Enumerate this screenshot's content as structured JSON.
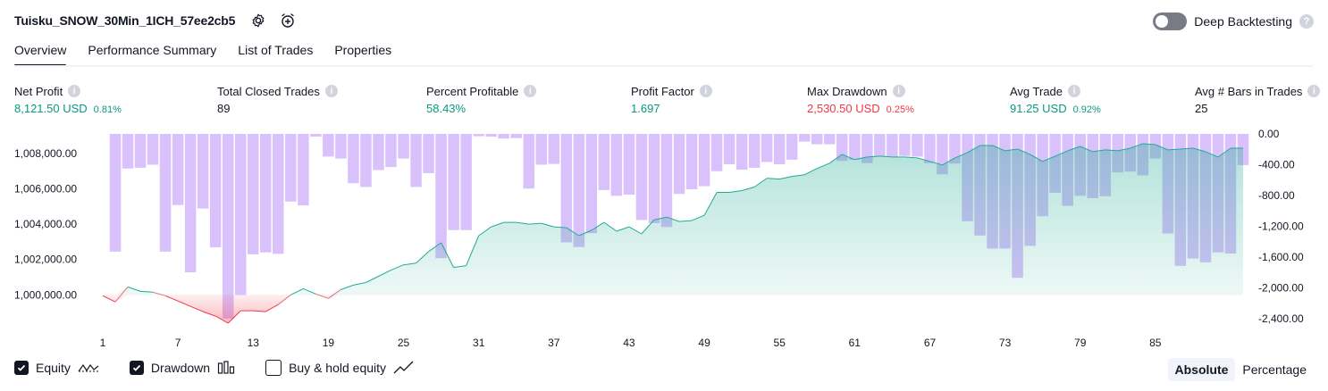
{
  "header": {
    "strategy_name": "Tuisku_SNOW_30Min_1ICH_57ee2cb5",
    "deep_backtesting_label": "Deep Backtesting",
    "deep_backtesting_enabled": false
  },
  "tabs": [
    {
      "label": "Overview",
      "active": true
    },
    {
      "label": "Performance Summary",
      "active": false
    },
    {
      "label": "List of Trades",
      "active": false
    },
    {
      "label": "Properties",
      "active": false
    }
  ],
  "stats": {
    "net_profit": {
      "label": "Net Profit",
      "value": "8,121.50 USD",
      "pct": "0.81%"
    },
    "total_closed_trades": {
      "label": "Total Closed Trades",
      "value": "89"
    },
    "percent_profitable": {
      "label": "Percent Profitable",
      "value": "58.43%"
    },
    "profit_factor": {
      "label": "Profit Factor",
      "value": "1.697"
    },
    "max_drawdown": {
      "label": "Max Drawdown",
      "value": "2,530.50 USD",
      "pct": "0.25%"
    },
    "avg_trade": {
      "label": "Avg Trade",
      "value": "91.25 USD",
      "pct": "0.92%"
    },
    "avg_bars": {
      "label": "Avg # Bars in Trades",
      "value": "25"
    }
  },
  "chart_data": {
    "type": "area",
    "x_ticks": [
      "1",
      "7",
      "13",
      "19",
      "25",
      "31",
      "37",
      "43",
      "49",
      "55",
      "61",
      "67",
      "73",
      "79",
      "85"
    ],
    "left_axis": {
      "ticks": [
        "1,008,000.00",
        "1,006,000.00",
        "1,004,000.00",
        "1,002,000.00",
        "1,000,000.00"
      ],
      "values": [
        1008000,
        1006000,
        1004000,
        1002000,
        1000000
      ],
      "ylim": [
        998400,
        1008500
      ]
    },
    "right_axis": {
      "ticks": [
        "0.00",
        "-400.00",
        "-800.00",
        "-1,200.00",
        "-1,600.00",
        "-2,000.00",
        "-2,400.00"
      ],
      "values": [
        0,
        -400,
        -800,
        -1200,
        -1600,
        -2000,
        -2400
      ],
      "ylim": [
        -2460,
        0
      ]
    },
    "initial_capital": 1000000,
    "equity": [
      999950,
      999600,
      1000450,
      1000200,
      1000150,
      999950,
      999650,
      999350,
      999050,
      998800,
      998400,
      999100,
      999100,
      999050,
      999450,
      1000000,
      1000350,
      1000050,
      999800,
      1000300,
      1000550,
      1000700,
      1001050,
      1001400,
      1001700,
      1001800,
      1002450,
      1002950,
      1001550,
      1001650,
      1003350,
      1003850,
      1004100,
      1004100,
      1004000,
      1004050,
      1003850,
      1003800,
      1003350,
      1003650,
      1004100,
      1003600,
      1003850,
      1003450,
      1004250,
      1004400,
      1004150,
      1004200,
      1004500,
      1005800,
      1005800,
      1005900,
      1006100,
      1006600,
      1006550,
      1006700,
      1006800,
      1007150,
      1007450,
      1007950,
      1007650,
      1007800,
      1007850,
      1007800,
      1007800,
      1007750,
      1007550,
      1007350,
      1007750,
      1008050,
      1008450,
      1008450,
      1008150,
      1008250,
      1007950,
      1007550,
      1007850,
      1008150,
      1008400,
      1008100,
      1008200,
      1008150,
      1008300,
      1008550,
      1008500,
      1008200,
      1008250,
      1008300,
      1008100,
      1007800,
      1008300,
      1008300
    ],
    "drawdown": [
      0,
      -1530,
      -450,
      -440,
      -400,
      -1530,
      -925,
      -1800,
      -970,
      -1475,
      -2400,
      -2095,
      -1565,
      -1540,
      -1560,
      -880,
      -930,
      -35,
      -295,
      -320,
      -640,
      -690,
      -470,
      -430,
      -320,
      -690,
      -510,
      -1615,
      -1250,
      -1250,
      -30,
      -35,
      -60,
      -55,
      -710,
      -400,
      -390,
      -1410,
      -1470,
      -1290,
      -730,
      -805,
      -790,
      -1120,
      -1160,
      -1210,
      -780,
      -720,
      -680,
      -485,
      -395,
      -465,
      -440,
      -365,
      -395,
      -335,
      -100,
      -135,
      -135,
      -350,
      -335,
      -380,
      -295,
      -300,
      -285,
      -295,
      -380,
      -525,
      -385,
      -1135,
      -1320,
      -1490,
      -1490,
      -1870,
      -1455,
      -1070,
      -765,
      -935,
      -805,
      -835,
      -810,
      -500,
      -490,
      -540,
      -320,
      -1295,
      -1715,
      -1620,
      -1670,
      -1540,
      -1555,
      -405
    ],
    "series": [
      {
        "name": "Equity",
        "color": "#22ab94"
      },
      {
        "name": "Drawdown",
        "color": "#d8b4fe"
      }
    ]
  },
  "legend": {
    "equity": {
      "label": "Equity",
      "checked": true
    },
    "drawdown": {
      "label": "Drawdown",
      "checked": true
    },
    "buy_hold": {
      "label": "Buy & hold equity",
      "checked": false
    }
  },
  "mode": {
    "absolute": "Absolute",
    "percentage": "Percentage",
    "active": "absolute"
  }
}
